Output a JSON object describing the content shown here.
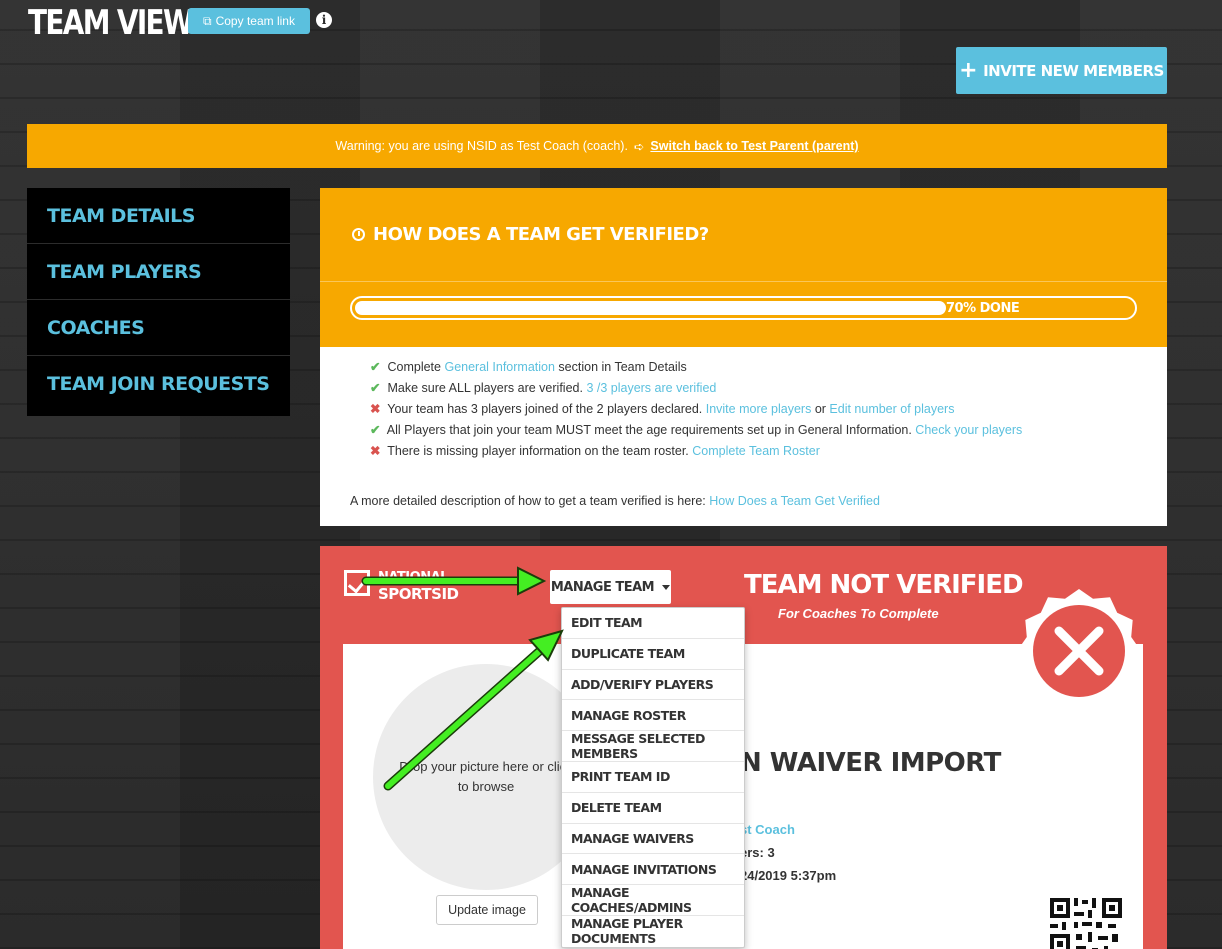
{
  "header": {
    "title": "TEAM VIEW",
    "copy_link_label": "Copy team link",
    "invite_label": "INVITE NEW MEMBERS"
  },
  "warning": {
    "text": "Warning: you are using NSID as Test Coach (coach).",
    "switch_link": "Switch back to Test Parent (parent)"
  },
  "sidebar": {
    "items": [
      {
        "label": "TEAM DETAILS"
      },
      {
        "label": "TEAM PLAYERS"
      },
      {
        "label": "COACHES"
      },
      {
        "label": "TEAM JOIN REQUESTS"
      }
    ]
  },
  "verification": {
    "title": "HOW DOES A TEAM GET VERIFIED?",
    "progress_percent": 70,
    "progress_label": "70% DONE",
    "checklist": [
      {
        "status": "ok",
        "pre": "Complete ",
        "link": "General Information",
        "post": " section in Team Details",
        "link2": "",
        "post2": ""
      },
      {
        "status": "ok",
        "pre": "Make sure ALL players are verified. ",
        "link": "3 /3 players are verified",
        "post": "",
        "link2": "",
        "post2": ""
      },
      {
        "status": "bad",
        "pre": "Your team has 3 players joined of the 2 players declared. ",
        "link": "Invite more players",
        "post": " or ",
        "link2": "Edit number of players",
        "post2": ""
      },
      {
        "status": "ok",
        "pre": "All Players that join your team MUST meet the age requirements set up in General Information. ",
        "link": "Check your players",
        "post": "",
        "link2": "",
        "post2": ""
      },
      {
        "status": "bad",
        "pre": "There is missing player information on the team roster. ",
        "link": "Complete Team Roster",
        "post": "",
        "link2": "",
        "post2": ""
      }
    ],
    "detail_text": "A more detailed description of how to get a team verified is here: ",
    "detail_link": "How Does a Team Get Verified"
  },
  "card": {
    "logo_line1": "NATIONAL",
    "logo_line2": "SPORTSID",
    "manage_label": "MANAGE TEAM",
    "status_title": "TEAM NOT VERIFIED",
    "status_subtitle": "For Coaches To Complete",
    "photo_text": "Drop your picture here or click to browse",
    "update_image_label": "Update image",
    "import_title": "N WAIVER IMPORT",
    "info_coach": "st Coach",
    "info_players": "ers: 3",
    "info_date": "24/2019 5:37pm"
  },
  "dropdown": {
    "items": [
      "EDIT TEAM",
      "DUPLICATE TEAM",
      "ADD/VERIFY PLAYERS",
      "MANAGE ROSTER",
      "MESSAGE SELECTED MEMBERS",
      "PRINT TEAM ID",
      "DELETE TEAM",
      "MANAGE WAIVERS",
      "MANAGE INVITATIONS",
      "MANAGE COACHES/ADMINS",
      "MANAGE PLAYER DOCUMENTS"
    ]
  },
  "colors": {
    "accent": "#5bc0de",
    "warning": "#f7a800",
    "danger": "#e2554f",
    "arrow": "#44ee22"
  }
}
